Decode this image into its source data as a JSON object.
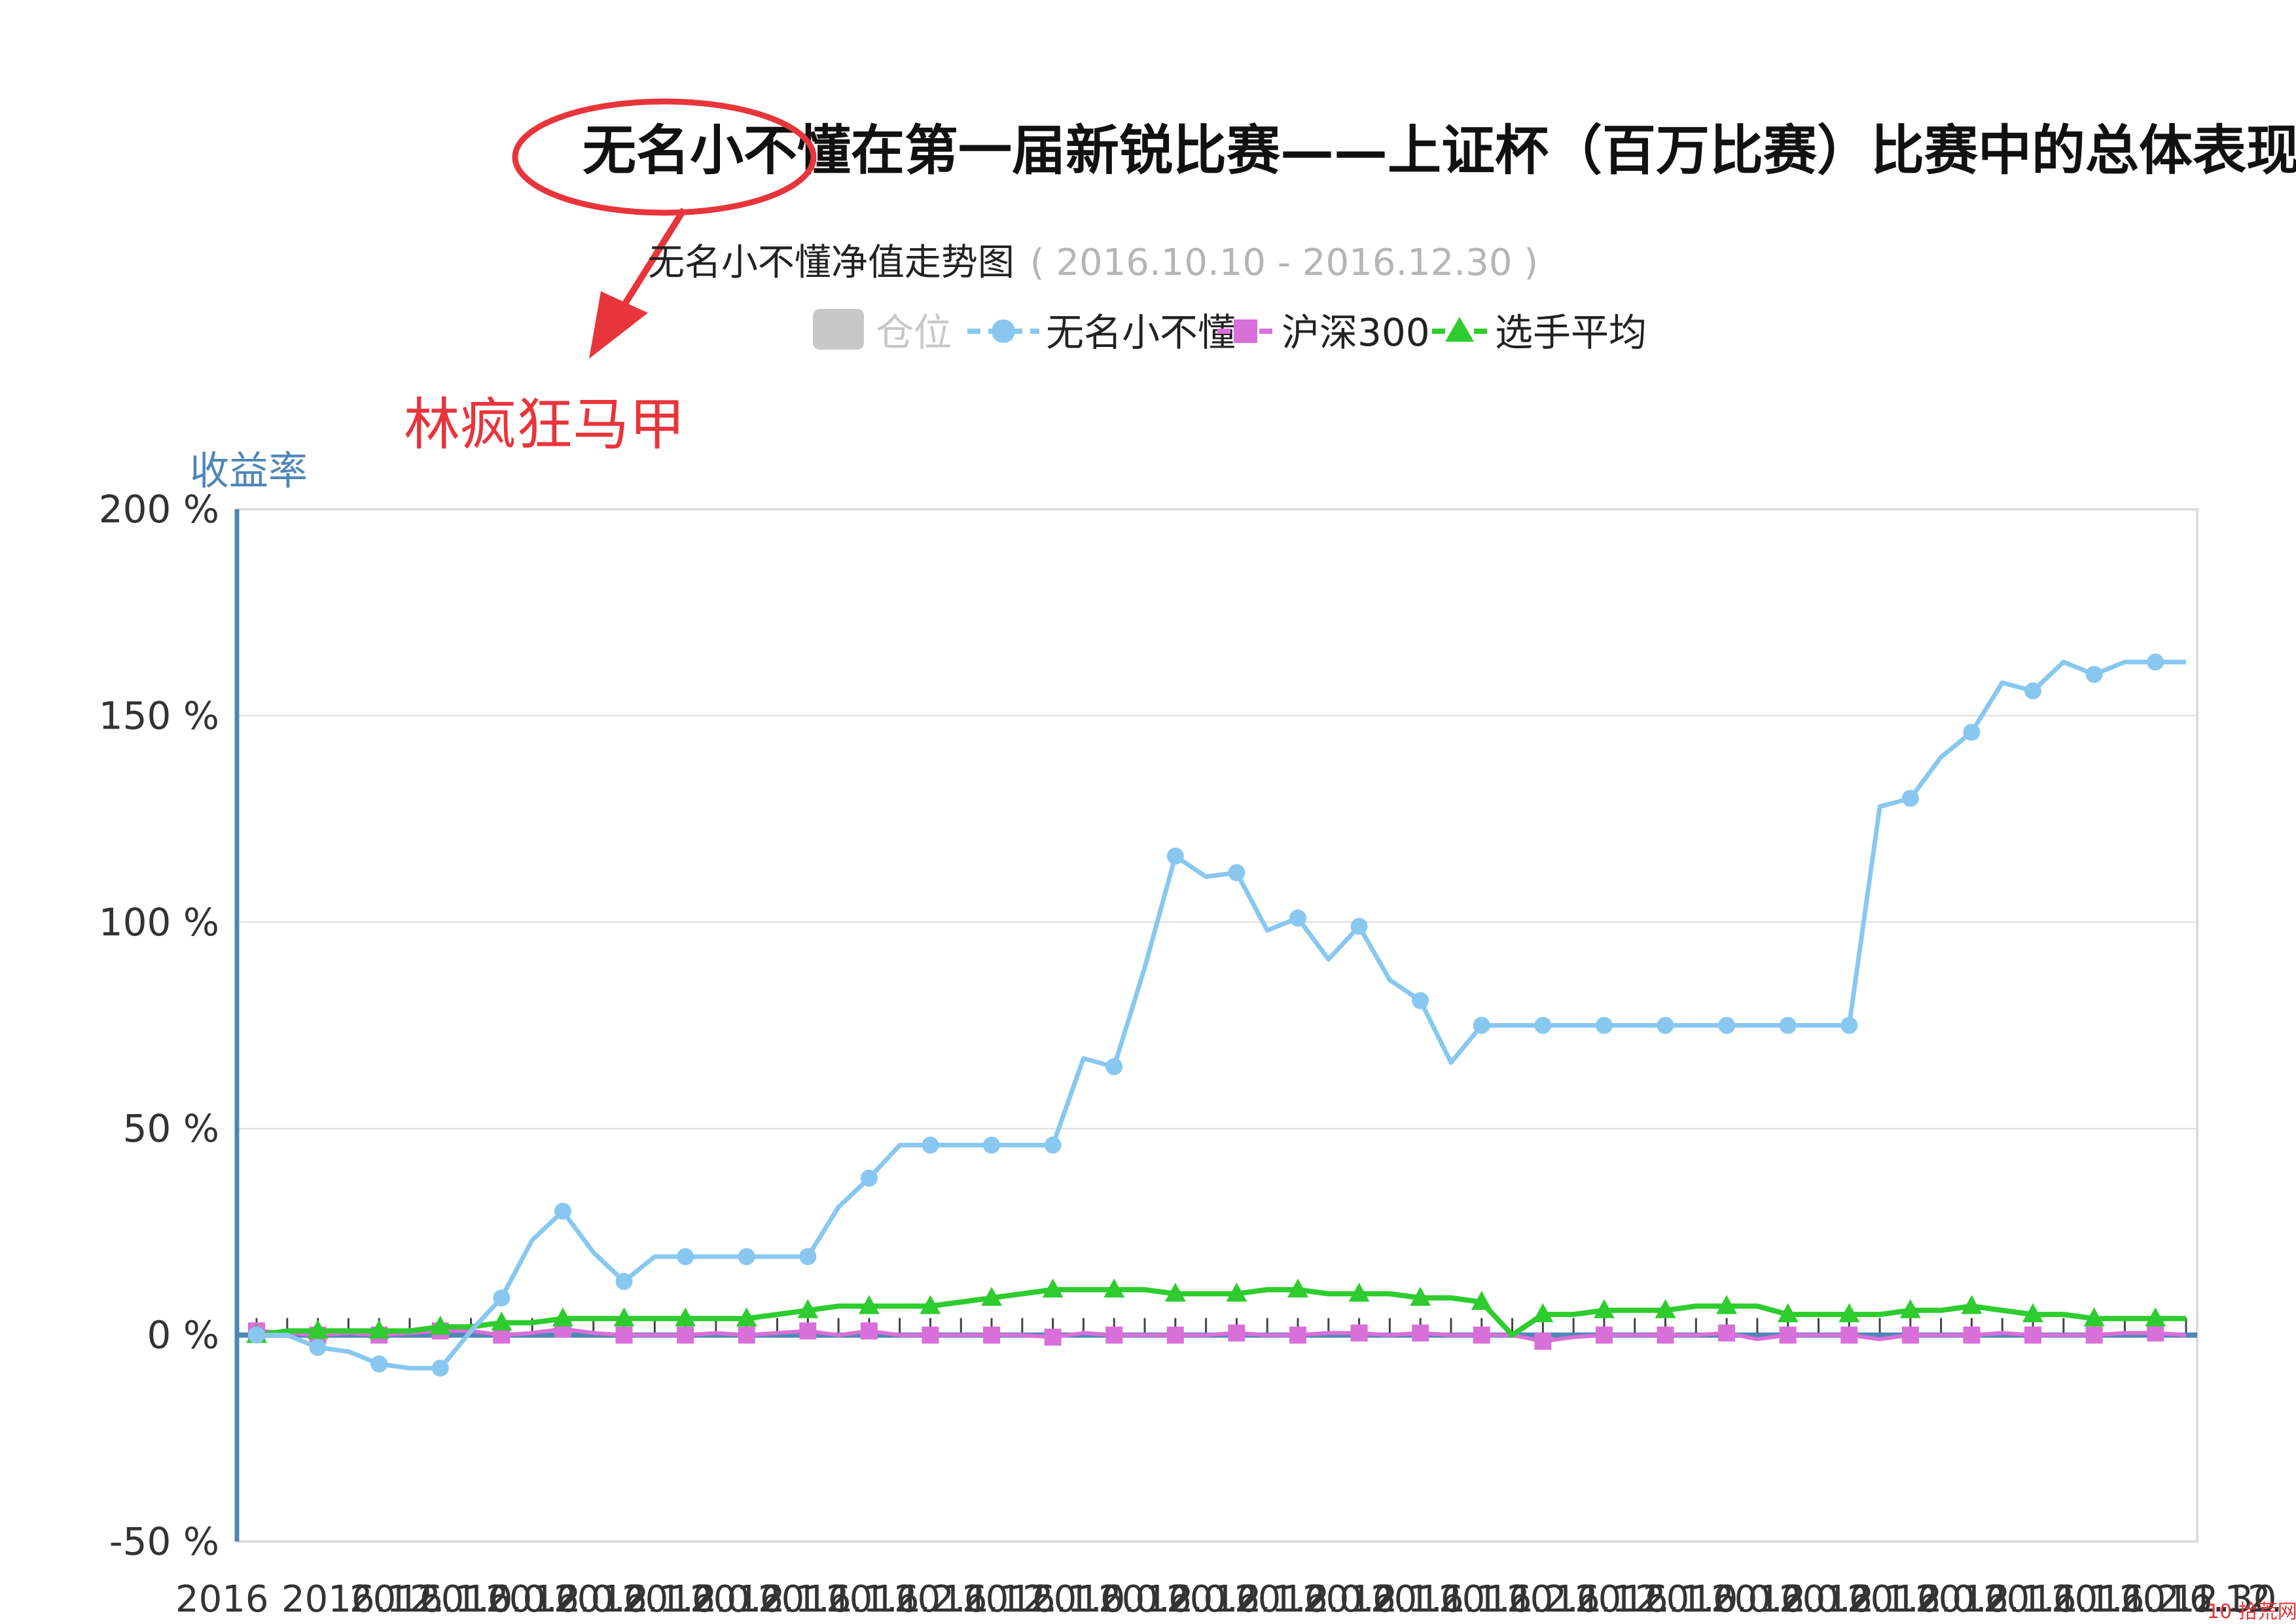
{
  "page": {
    "title": "无名小不懂在第一届新锐比赛——上证杯（百万比赛）比赛中的总体表现",
    "annotation": "林疯狂马甲",
    "watermark": "10 拾荒网"
  },
  "colors": {
    "circle": "#e8353b",
    "annotation": "#e8353b",
    "axis": "#4f86b8",
    "grid": "#dedede",
    "tick_text": "#333333",
    "cangwei": "#c8c8c8",
    "wuming": "#88c8f0",
    "hs300": "#d96fd9",
    "avg": "#2ecc2e"
  },
  "chart_data": {
    "type": "line",
    "title": "无名小不懂净值走势图",
    "subtitle": "( 2016.10.10 - 2016.12.30 )",
    "ylabel": "收益率",
    "ylim": [
      -50,
      200
    ],
    "y_ticks": [
      "200 %",
      "150 %",
      "100 %",
      "50 %",
      "0 %",
      "-50 %"
    ],
    "y_tick_values": [
      200,
      150,
      100,
      50,
      0,
      -50
    ],
    "x_label_text": "2016.10.10 ... 2016.12.30",
    "x_first_label": "2016",
    "x_last_label": "12.30",
    "legend": [
      "仓位",
      "无名小不懂",
      "沪深300",
      "选手平均"
    ],
    "legend_position": "top",
    "series": [
      {
        "name": "无名小不懂",
        "values": [
          0,
          0,
          -3,
          -4,
          -7,
          -8,
          -8,
          1,
          9,
          23,
          30,
          20,
          13,
          19,
          19,
          19,
          19,
          19,
          19,
          31,
          38,
          46,
          46,
          46,
          46,
          46,
          46,
          67,
          65,
          89,
          116,
          111,
          112,
          98,
          101,
          91,
          99,
          86,
          81,
          66,
          75,
          75,
          75,
          75,
          75,
          75,
          75,
          75,
          75,
          75,
          75,
          75,
          75,
          128,
          130,
          140,
          146,
          158,
          156,
          163,
          160,
          163,
          163,
          163
        ]
      },
      {
        "name": "沪深300",
        "values": [
          1,
          0.5,
          0,
          0.5,
          0,
          0.5,
          1,
          1,
          0,
          0.5,
          1.5,
          0.5,
          0,
          0,
          0,
          0.5,
          0,
          0.5,
          1,
          0,
          1,
          0,
          0,
          0,
          0,
          0,
          -0.5,
          0.5,
          0,
          0,
          0,
          0,
          0.5,
          0,
          0,
          0.5,
          0.5,
          0,
          0.5,
          0,
          0,
          0,
          -1.5,
          -0.5,
          0,
          0,
          0,
          0,
          0.5,
          -1,
          0,
          0,
          0,
          -1,
          0,
          0,
          0,
          0.5,
          0,
          0,
          0,
          0.5,
          0.5,
          0
        ]
      },
      {
        "name": "选手平均",
        "values": [
          0,
          1,
          1,
          1,
          1,
          1,
          2,
          2,
          3,
          3,
          4,
          4,
          4,
          4,
          4,
          4,
          4,
          5,
          6,
          7,
          7,
          7,
          7,
          8,
          9,
          10,
          11,
          11,
          11,
          11,
          10,
          10,
          10,
          11,
          11,
          10,
          10,
          10,
          9,
          9,
          8,
          0,
          5,
          5,
          6,
          6,
          6,
          7,
          7,
          7,
          5,
          5,
          5,
          5,
          6,
          6,
          7,
          6,
          5,
          5,
          4,
          4,
          4,
          4
        ]
      }
    ]
  }
}
